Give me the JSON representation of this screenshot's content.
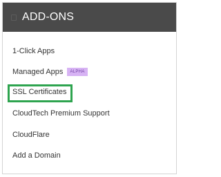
{
  "panel": {
    "title": "ADD-ONS",
    "items": [
      {
        "label": "1-Click Apps"
      },
      {
        "label": "Managed Apps",
        "badge": "ALPHA"
      },
      {
        "label": "SSL Certificates"
      },
      {
        "label": "CloudTech Premium Support"
      },
      {
        "label": "CloudFlare"
      },
      {
        "label": "Add a Domain"
      }
    ]
  },
  "colors": {
    "header_bg": "#4a4a4a",
    "badge_bg": "#d7b3f4",
    "badge_text": "#6e3fa1",
    "highlight": "#2ea44f"
  }
}
